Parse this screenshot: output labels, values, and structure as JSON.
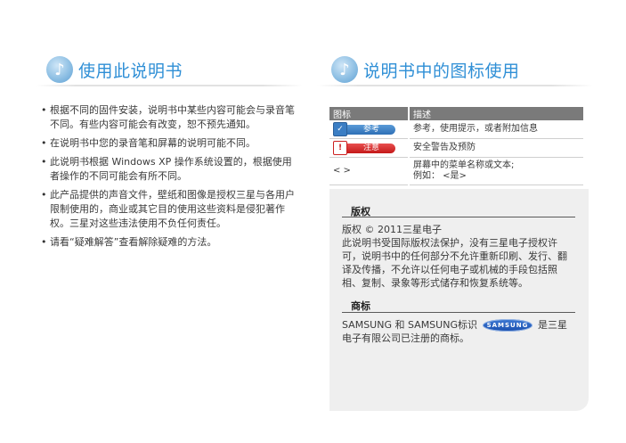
{
  "left": {
    "title": "使用此说明书",
    "items": [
      "根据不同的固件安装，说明书中某些内容可能会与录音笔不同。有些内容可能会有改变，恕不预先通知。",
      "在说明书中您的录音笔和屏幕的说明可能不同。",
      "此说明书根据 Windows XP 操作系统设置的，根据使用者操作的不同可能会有所不同。",
      "此产品提供的声音文件，壁纸和图像是授权三星与各用户限制使用的，商业或其它目的使用这些资料是侵犯著作权。三星对这些违法使用不负任何责任。",
      "请看“疑难解答”查看解除疑难的方法。"
    ]
  },
  "right": {
    "title": "说明书中的图标使用",
    "table": {
      "headers": [
        "图标",
        "描述"
      ],
      "rows": [
        {
          "badge": "参考",
          "badge_icon": "reference-icon",
          "desc": "参考，使用提示，或者附加信息"
        },
        {
          "badge": "注意",
          "badge_icon": "warning-icon",
          "desc": "安全警告及预防"
        },
        {
          "symbol": "<  >",
          "desc_line1": "屏幕中的菜单名称或文本;",
          "desc_line2": "例如： <是>"
        }
      ]
    },
    "copyright": {
      "title": "版权",
      "body": "版权 © 2011三星电子\n此说明书受国际版权法保护，没有三星电子授权许可，说明书中的任何部分不允许重新印刷、发行、翻译及传播，不允许以任何电子或机械的手段包括照相、复制、录象等形式储存和恢复系统等。"
    },
    "trademark": {
      "title": "商标",
      "body_before": "SAMSUNG 和 SAMSUNG标识",
      "logo_text": "SAMSUNG",
      "body_after": "是三星电子有限公司已注册的商标。"
    }
  },
  "colors": {
    "title_blue": "#2f8fd6",
    "table_header": "#7a7a7a",
    "info_box": "#efefef"
  }
}
